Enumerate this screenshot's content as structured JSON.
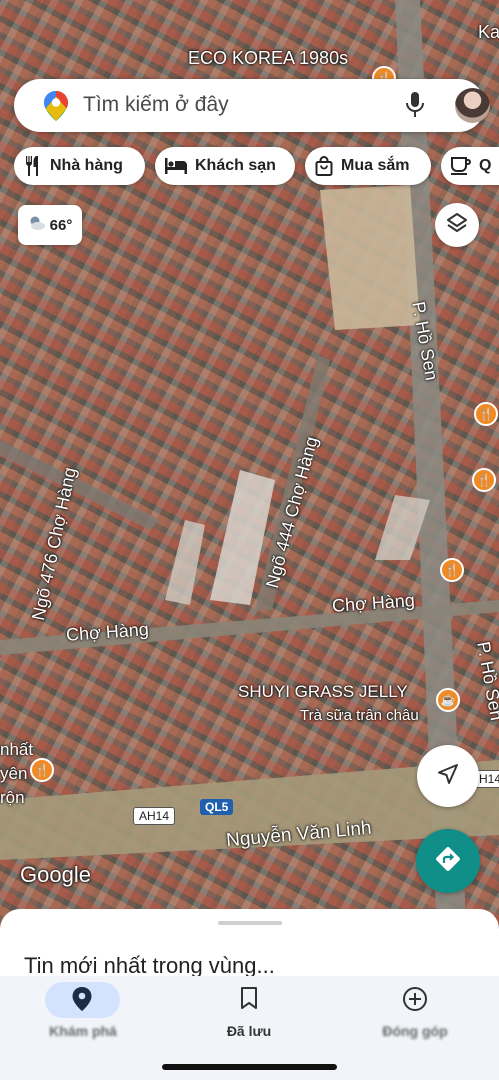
{
  "search": {
    "placeholder": "Tìm kiếm ở đây"
  },
  "chips": [
    {
      "label": "Nhà hàng",
      "icon": "fork-knife-icon"
    },
    {
      "label": "Khách sạn",
      "icon": "bed-icon"
    },
    {
      "label": "Mua sắm",
      "icon": "shopping-bag-icon"
    },
    {
      "label": "Q",
      "icon": "coffee-cup-icon"
    }
  ],
  "weather": {
    "temp": "66°",
    "icon": "partly-cloudy-icon"
  },
  "map_labels": {
    "eco_korea": "ECO KOREA 1980s",
    "top_right": "Ka",
    "ho_sen_1": "P. Hồ Sen",
    "ho_sen_2": "P. Hồ Sen",
    "ngo_444": "Ngõ 444 Chợ Hàng",
    "ngo_476": "Ngõ 476 Chợ Hàng",
    "cho_hang_1": "Chợ Hàng",
    "cho_hang_2": "Chợ Hàng",
    "shuyi": "SHUYI GRASS JELLY",
    "tra_sua": "Trà sữa trân châu",
    "nguyen_van_linh": "Nguyễn Văn Linh",
    "left_edge": "nhất\nyên\nrộn",
    "ah14_a": "AH14",
    "ah14_b": "H14",
    "ql5": "QL5"
  },
  "google_logo": "Google",
  "sheet": {
    "title": "Tin mới nhất trong vùng..."
  },
  "nav": [
    {
      "label": "Khám phá",
      "icon": "location-pin-icon",
      "active": true
    },
    {
      "label": "Đã lưu",
      "icon": "bookmark-icon",
      "active": false
    },
    {
      "label": "Đóng góp",
      "icon": "add-circle-icon",
      "active": false
    }
  ],
  "colors": {
    "accent_pill": "#d3e3fd",
    "directions_button": "#0f8f87",
    "poi": "#f08a24"
  }
}
